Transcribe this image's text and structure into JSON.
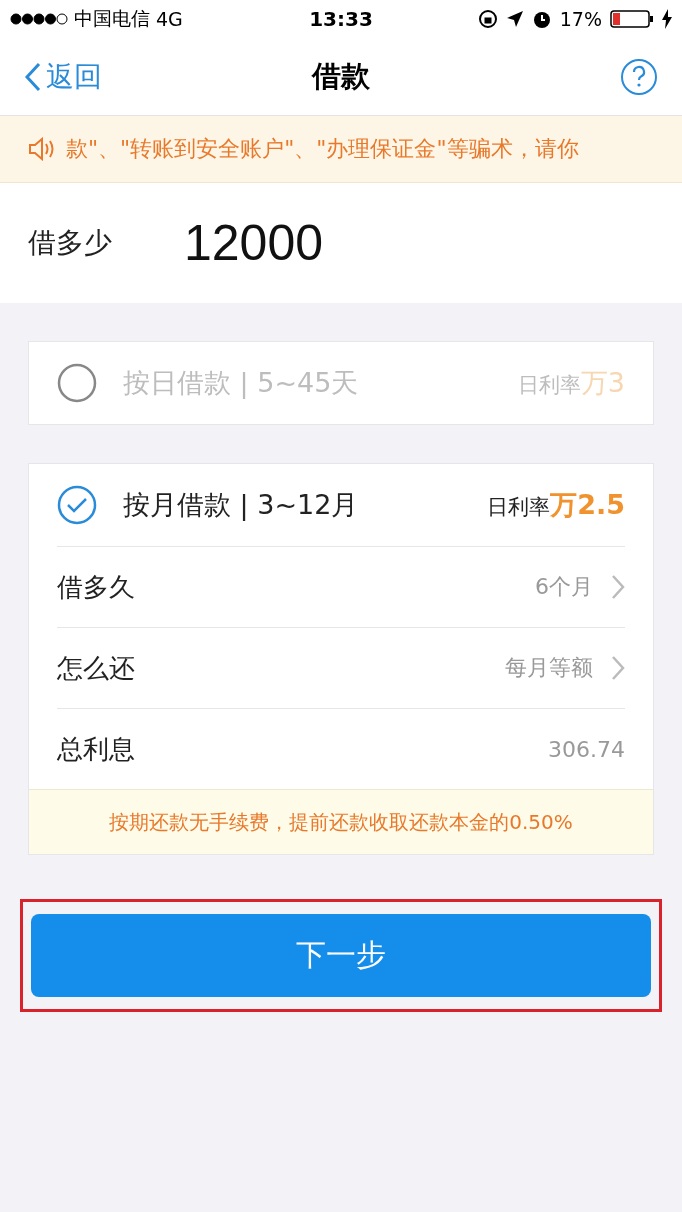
{
  "status_bar": {
    "carrier": "中国电信",
    "network": "4G",
    "time": "13:33",
    "battery": "17%"
  },
  "nav": {
    "back": "返回",
    "title": "借款"
  },
  "notice": {
    "text": "款\"、\"转账到安全账户\"、\"办理保证金\"等骗术，请你"
  },
  "amount": {
    "label": "借多少",
    "value": "12000"
  },
  "plans": [
    {
      "label": "按日借款 | 5~45天",
      "rate_label": "日利率",
      "rate": "万3",
      "selected": false
    },
    {
      "label": "按月借款 | 3~12月",
      "rate_label": "日利率",
      "rate": "万2.5",
      "selected": true,
      "rows": [
        {
          "label": "借多久",
          "value": "6个月",
          "chevron": true
        },
        {
          "label": "怎么还",
          "value": "每月等额",
          "chevron": true
        },
        {
          "label": "总利息",
          "value": "306.74",
          "chevron": false
        }
      ],
      "note": "按期还款无手续费，提前还款收取还款本金的0.50%"
    }
  ],
  "next_button": {
    "label": "下一步",
    "highlighted": true
  }
}
